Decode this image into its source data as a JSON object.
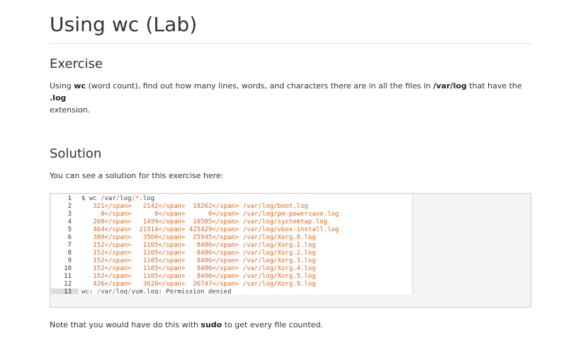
{
  "page": {
    "title": "Using wc (Lab)"
  },
  "exercise": {
    "heading": "Exercise",
    "text_1": "Using ",
    "bold_1": "wc",
    "text_2": " (word count), find out how many lines, words, and characters there are in all the files in ",
    "bold_2": "/var/log",
    "text_3": " that have the ",
    "bold_3": ".log",
    "text_4": "extension."
  },
  "solution": {
    "heading": "Solution",
    "intro": "You can see a solution for this exercise here:"
  },
  "code": {
    "lines": [
      {
        "n": "1",
        "text": "$ wc /var/log/*.log"
      },
      {
        "n": "2",
        "text": "   321   2142  18262 /var/log/boot.log"
      },
      {
        "n": "3",
        "text": "     0      0      0 /var/log/pm-powersave.log"
      },
      {
        "n": "4",
        "text": "   260   1499  10505 /var/log/systemtap.log"
      },
      {
        "n": "5",
        "text": "   464  21914 425429 /var/log/vbox-install.log"
      },
      {
        "n": "6",
        "text": "   380   3566  25945 /var/log/Xorg.0.log"
      },
      {
        "n": "7",
        "text": "   152   1105   8406 /var/log/Xorg.1.log"
      },
      {
        "n": "8",
        "text": "   152   1105   8406 /var/log/Xorg.2.log"
      },
      {
        "n": "9",
        "text": "   152   1105   8406 /var/log/Xorg.3.log"
      },
      {
        "n": "10",
        "text": "   152   1105   8406 /var/log/Xorg.4.log"
      },
      {
        "n": "11",
        "text": "   152   1105   8406 /var/log/Xorg.5.log"
      },
      {
        "n": "12",
        "text": "   426   3620  26747 /var/log/Xorg.9.log"
      },
      {
        "n": "13",
        "text": "wc: /var/log/yum.log: Permission denied"
      }
    ]
  },
  "note": {
    "text_1": "Note that you would have do this with ",
    "bold": "sudo",
    "text_2": " to get every file counted."
  },
  "colors": {
    "number": "#e0651a",
    "active_line": "#dddddd"
  }
}
